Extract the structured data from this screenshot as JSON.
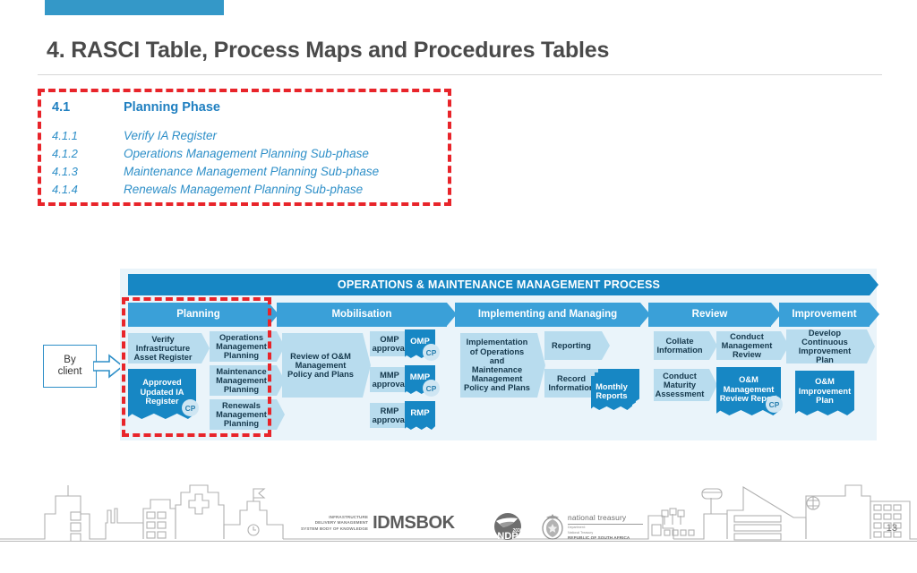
{
  "slide": {
    "title": "4.  RASCI Table, Process Maps and Procedures Tables",
    "page_number": "13",
    "accent_color": "#3498c8",
    "highlight_color": "#e8242a"
  },
  "toc": {
    "heading_number": "4.1",
    "heading_text": "Planning Phase",
    "items": [
      {
        "number": "4.1.1",
        "text": "Verify IA Register"
      },
      {
        "number": "4.1.2",
        "text": "Operations Management Planning Sub-phase"
      },
      {
        "number": "4.1.3",
        "text": "Maintenance Management Planning Sub-phase"
      },
      {
        "number": "4.1.4",
        "text": "Renewals Management Planning Sub-phase"
      }
    ]
  },
  "by_client": {
    "line1": "By",
    "line2": "client"
  },
  "diagram": {
    "title": "OPERATIONS & MAINTENANCE MANAGEMENT PROCESS",
    "phases": [
      {
        "label": "Planning"
      },
      {
        "label": "Mobilisation"
      },
      {
        "label": "Implementing and Managing"
      },
      {
        "label": "Review"
      },
      {
        "label": "Improvement"
      }
    ],
    "steps": {
      "verify_ia": "Verify Infrastructure Asset Register",
      "ops_planning": "Operations Management Planning",
      "maint_planning": "Maintenance Management Planning",
      "renew_planning": "Renewals Management Planning",
      "review_om": "Review of O&M Management Policy and Plans",
      "omp_approval": "OMP approval",
      "mmp_approval": "MMP approval",
      "rmp_approval": "RMP approval",
      "implementation": "Implementation of Operations and Maintenance Management Policy and Plans",
      "reporting": "Reporting",
      "record_info": "Record Information",
      "collate_info": "Collate Information",
      "conduct_review": "Conduct Management Review",
      "conduct_maturity": "Conduct Maturity Assessment",
      "develop_cip": "Develop Continuous Improvement Plan"
    },
    "documents": {
      "approved_ia": "Approved Updated IA Register",
      "omp": "OMP",
      "mmp": "MMP",
      "rmp": "RMP",
      "monthly_reports": "Monthly Reports",
      "om_review_report": "O&M Management Review Report",
      "om_improvement_plan": "O&M Improvement Plan"
    },
    "control_point_label": "CP",
    "colors": {
      "panel_bg": "#eaf4fa",
      "title_bar": "#1787c4",
      "phase_header": "#3aa0d8",
      "step": "#b8dcee",
      "document": "#1787c4",
      "cp_badge": "#cfe6f3"
    }
  },
  "footer": {
    "idmsbok": {
      "line1": "INFRASTRUCTURE",
      "line2": "DELIVERY MANAGEMENT",
      "line3": "SYSTEM BODY OF KNOWLEDGE",
      "wordmark": "IDMSBOK"
    },
    "ndp": {
      "label": "NDP",
      "year": "2030"
    },
    "national_treasury": {
      "title": "national treasury",
      "sub1": "Department:",
      "sub2": "National Treasury",
      "sub3": "REPUBLIC OF SOUTH AFRICA"
    }
  }
}
